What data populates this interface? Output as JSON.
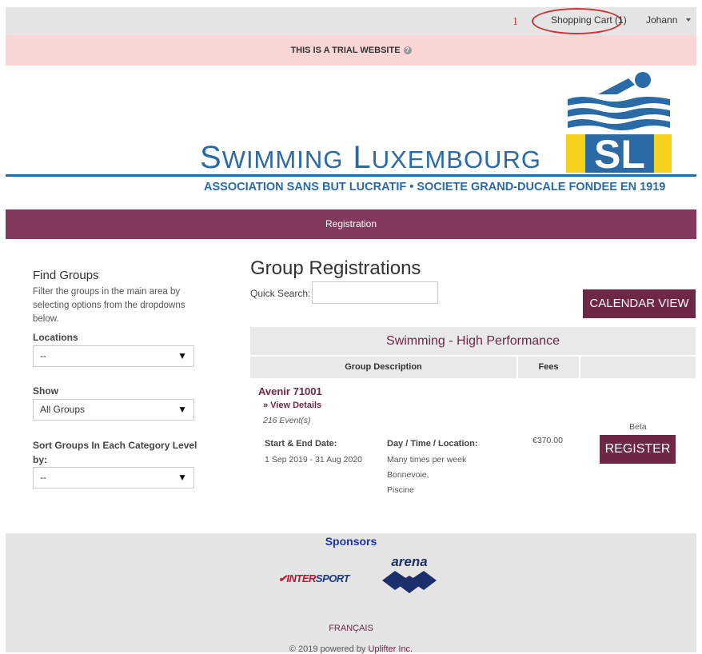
{
  "header": {
    "annotation_number": "1",
    "cart_label": "Shopping Cart (1)",
    "user_name": "Johann"
  },
  "trial_banner": "THIS IS A TRIAL WEBSITE",
  "brand": {
    "title": "Swimming Luxembourg",
    "subtitle": "ASSOCIATION SANS BUT LUCRATIF • SOCIETE GRAND-DUCALE FONDEE EN 1919",
    "logo_text": "SL",
    "primary_color": "#2a6aa7",
    "accent_color": "#f4d21c"
  },
  "nav": {
    "registration": "Registration"
  },
  "sidebar": {
    "title": "Find Groups",
    "description": "Filter the groups in the main area by selecting options from the dropdowns below.",
    "locations_label": "Locations",
    "locations_value": "--",
    "show_label": "Show",
    "show_value": "All Groups",
    "sort_label": "Sort Groups In Each Category Level by:",
    "sort_value": "--"
  },
  "main": {
    "title": "Group Registrations",
    "quick_search_label": "Quick Search:",
    "quick_search_value": "",
    "calendar_view": "CALENDAR VIEW",
    "category": "Swimming - High Performance",
    "columns": [
      "Group Description",
      "Fees"
    ],
    "group": {
      "name": "Avenir 71001",
      "view_details": "» View Details",
      "events": "216 Event(s)",
      "dates_label": "Start & End Date:",
      "dates_value": "1 Sep 2019 - 31 Aug 2020",
      "schedule_label": "Day / Time / Location:",
      "schedule_frequency": "Many times per week",
      "schedule_place": "Bonnevoie,",
      "schedule_venue": "Piscine",
      "fee": "€370.00",
      "status": "Beta",
      "register": "REGISTER"
    }
  },
  "footer": {
    "sponsors_title": "Sponsors",
    "sponsor_1": "INTERSPORT",
    "sponsor_2": "arena",
    "language": "FRANÇAIS",
    "copyright_prefix": "© 2019 powered by ",
    "copyright_link": "Uplifter Inc."
  }
}
